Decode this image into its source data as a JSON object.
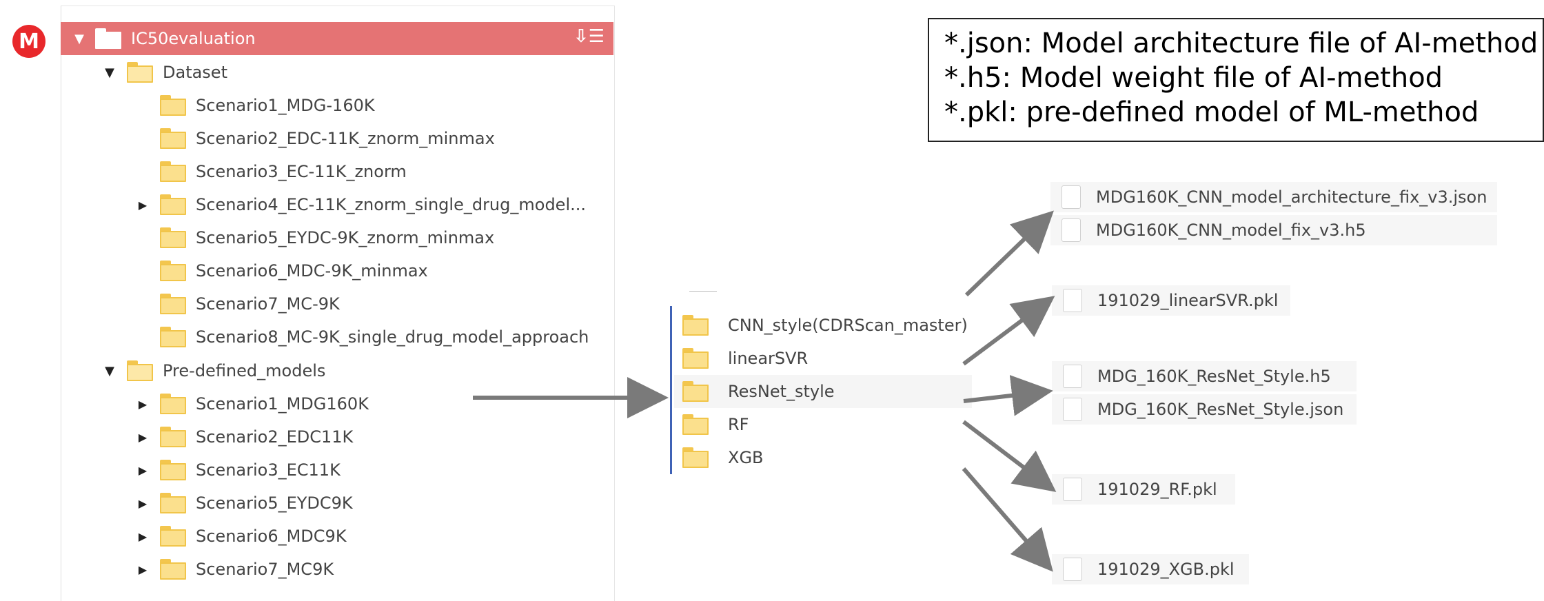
{
  "app": {
    "logo_letter": "M"
  },
  "tree": {
    "root": {
      "label": "IC50evaluation"
    },
    "dataset": {
      "label": "Dataset",
      "items": [
        {
          "label": "Scenario1_MDG-160K",
          "expandable": false
        },
        {
          "label": "Scenario2_EDC-11K_znorm_minmax",
          "expandable": false
        },
        {
          "label": "Scenario3_EC-11K_znorm",
          "expandable": false
        },
        {
          "label": "Scenario4_EC-11K_znorm_single_drug_model...",
          "expandable": true
        },
        {
          "label": "Scenario5_EYDC-9K_znorm_minmax",
          "expandable": false
        },
        {
          "label": "Scenario6_MDC-9K_minmax",
          "expandable": false
        },
        {
          "label": "Scenario7_MC-9K",
          "expandable": false
        },
        {
          "label": "Scenario8_MC-9K_single_drug_model_approach",
          "expandable": false
        }
      ]
    },
    "predefined": {
      "label": "Pre-defined_models",
      "items": [
        {
          "label": "Scenario1_MDG160K"
        },
        {
          "label": "Scenario2_EDC11K"
        },
        {
          "label": "Scenario3_EC11K"
        },
        {
          "label": "Scenario5_EYDC9K"
        },
        {
          "label": "Scenario6_MDC9K"
        },
        {
          "label": "Scenario7_MC9K"
        }
      ]
    }
  },
  "middle": {
    "folders": [
      {
        "label": "CNN_style(CDRScan_master)"
      },
      {
        "label": "linearSVR"
      },
      {
        "label": "ResNet_style"
      },
      {
        "label": "RF"
      },
      {
        "label": "XGB"
      }
    ]
  },
  "files": {
    "cnn": [
      "MDG160K_CNN_model_architecture_fix_v3.json",
      "MDG160K_CNN_model_fix_v3.h5"
    ],
    "svr": [
      "191029_linearSVR.pkl"
    ],
    "resnet": [
      "MDG_160K_ResNet_Style.h5",
      "MDG_160K_ResNet_Style.json"
    ],
    "rf": [
      "191029_RF.pkl"
    ],
    "xgb": [
      "191029_XGB.pkl"
    ]
  },
  "legend": {
    "lines": [
      "*.json: Model architecture file of AI-method",
      "*.h5: Model weight file of AI-method",
      "*.pkl: pre-defined model of ML-method"
    ]
  },
  "colors": {
    "root_highlight": "#e57374",
    "folder_yellow": "#fbe08d",
    "arrow": "#7a7a7a",
    "mega_red": "#e8282b",
    "selection_bar": "#3f62b6"
  }
}
